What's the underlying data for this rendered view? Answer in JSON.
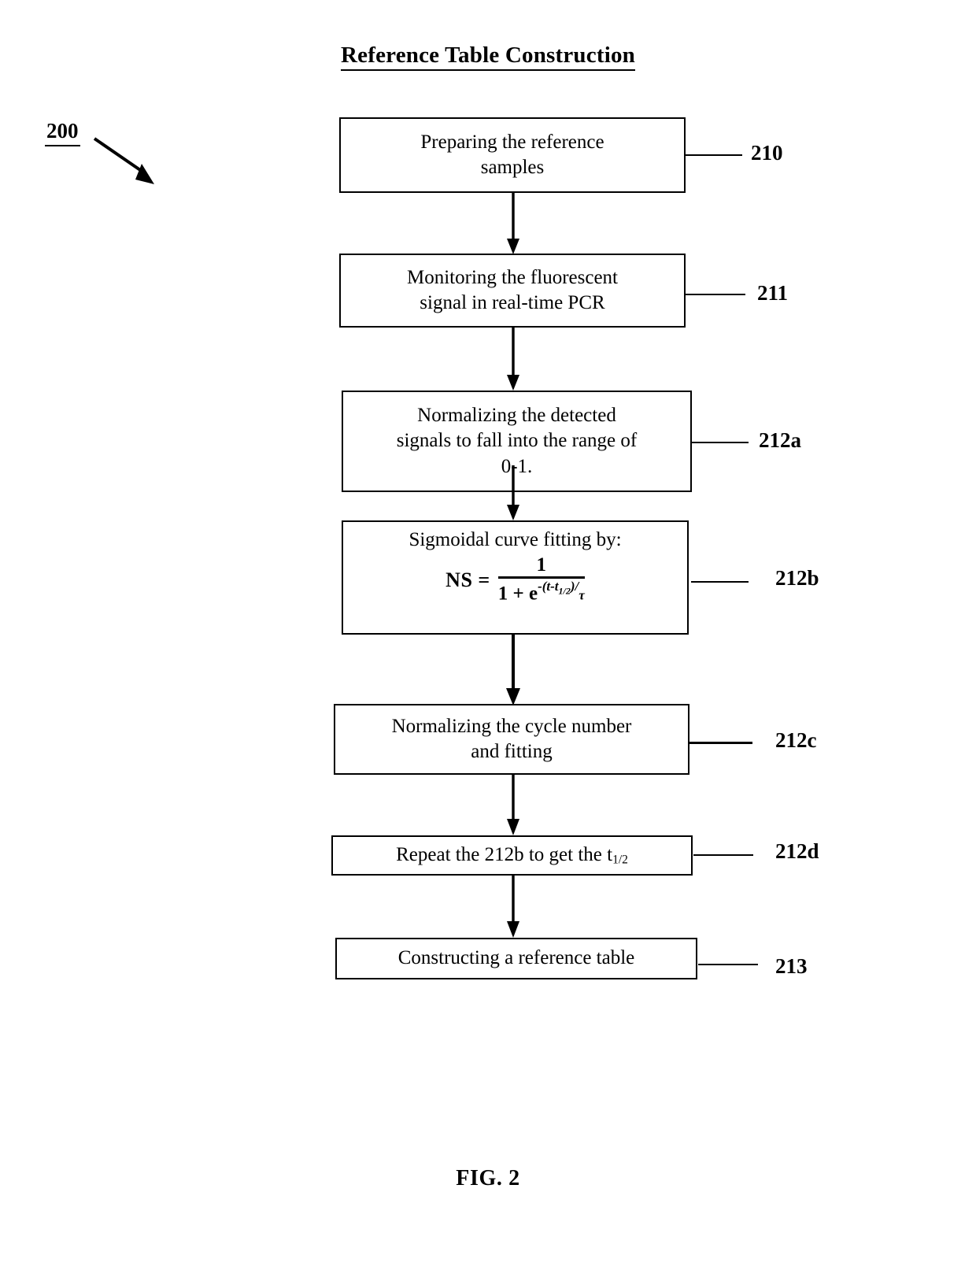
{
  "figure": {
    "title": "Reference Table Construction",
    "caption": "FIG. 2",
    "diagram_ref": "200"
  },
  "flowchart": {
    "type": "flowchart",
    "orientation": "top-to-bottom",
    "steps": [
      {
        "id": "210",
        "ref_label": "210",
        "text": "Preparing the reference samples",
        "lines": [
          "Preparing the reference",
          "samples"
        ]
      },
      {
        "id": "211",
        "ref_label": "211",
        "text": "Monitoring the fluorescent signal in real-time PCR",
        "lines": [
          "Monitoring the fluorescent",
          "signal in real-time PCR"
        ]
      },
      {
        "id": "212a",
        "ref_label": "212a",
        "text": "Normalizing the detected signals to fall into the range of 0-1.",
        "lines": [
          "Normalizing the detected",
          "signals to fall into the range of",
          "0-1."
        ]
      },
      {
        "id": "212b",
        "ref_label": "212b",
        "text": "Sigmoidal curve fitting by: NS = 1 / (1 + e^(-(t-t1/2)/τ))",
        "heading": "Sigmoidal curve fitting by:",
        "formula": {
          "lhs": "NS",
          "equals": "=",
          "numerator": "1",
          "denominator_base": "1 + e",
          "exponent": "-(t-t",
          "exponent_sub": "1/2",
          "exponent_close": ")/",
          "exponent_tau": "τ"
        }
      },
      {
        "id": "212c",
        "ref_label": "212c",
        "text": "Normalizing the cycle number and fitting",
        "lines": [
          "Normalizing the cycle number",
          "and fitting"
        ]
      },
      {
        "id": "212d",
        "ref_label": "212d",
        "text": "Repeat the 212b to get the t1/2",
        "prefix": "Repeat the 212b to get the t",
        "subscript": "1/2"
      },
      {
        "id": "213",
        "ref_label": "213",
        "text": "Constructing a reference table",
        "lines": [
          "Constructing a reference table"
        ]
      }
    ]
  },
  "style": {
    "line_color": "#000000",
    "box_fill": "#ffffff",
    "page_background": "#ffffff"
  }
}
